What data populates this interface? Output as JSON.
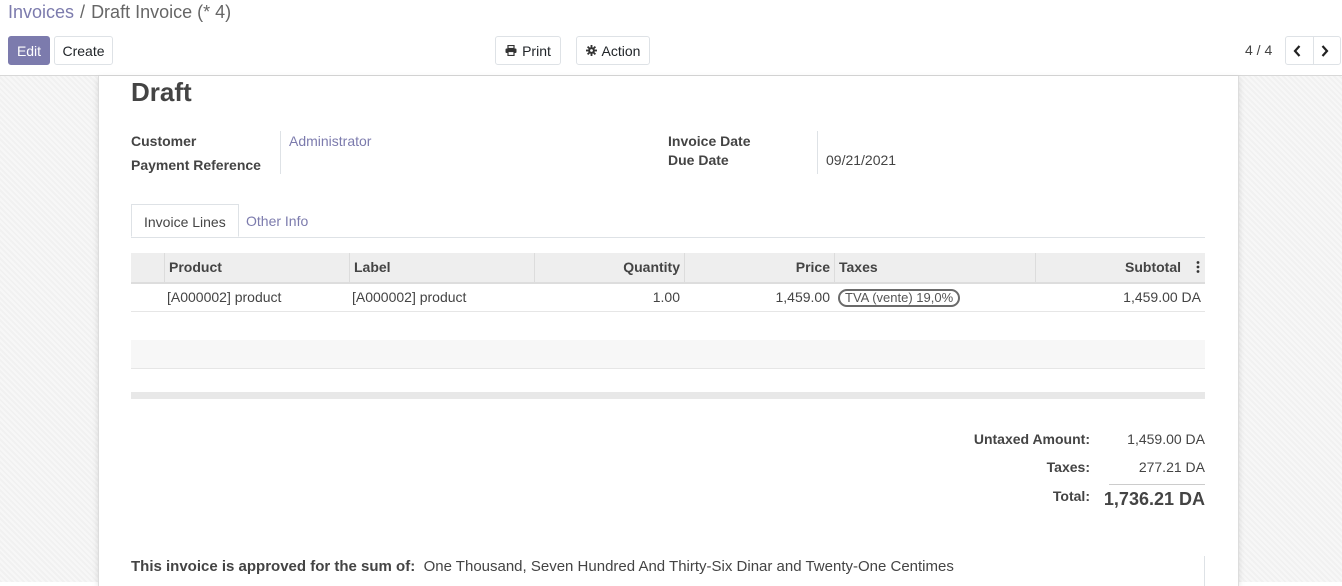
{
  "breadcrumb": {
    "parent": "Invoices",
    "separator": "/",
    "current": "Draft Invoice (* 4)"
  },
  "toolbar": {
    "edit": "Edit",
    "create": "Create",
    "print": "Print",
    "action": "Action"
  },
  "pager": {
    "value": "4 / 4"
  },
  "form": {
    "status": "Draft",
    "customer_label": "Customer",
    "customer_value": "Administrator",
    "payment_ref_label": "Payment Reference",
    "payment_ref_value": "",
    "invoice_date_label": "Invoice Date",
    "invoice_date_value": "",
    "due_date_label": "Due Date",
    "due_date_value": "09/21/2021"
  },
  "tabs": [
    {
      "label": "Invoice Lines"
    },
    {
      "label": "Other Info"
    }
  ],
  "lines_table": {
    "columns": [
      "Product",
      "Label",
      "Quantity",
      "Price",
      "Taxes",
      "Subtotal"
    ],
    "rows": [
      {
        "product": "[A000002] product",
        "label": "[A000002] product",
        "quantity": "1.00",
        "price": "1,459.00",
        "taxes": "TVA (vente) 19,0%",
        "subtotal": "1,459.00 DA"
      }
    ]
  },
  "totals": {
    "untaxed_label": "Untaxed Amount:",
    "untaxed_value": "1,459.00 DA",
    "taxes_label": "Taxes:",
    "taxes_value": "277.21 DA",
    "total_label": "Total:",
    "total_value": "1,736.21 DA"
  },
  "amount_in_words": {
    "label": "This invoice is approved for the sum of:",
    "value": "One Thousand, Seven Hundred And Thirty-Six Dinar and Twenty-One Centimes"
  },
  "icons": {
    "print": "printer-icon",
    "action": "gear-icon",
    "prev": "chevron-left-icon",
    "next": "chevron-right-icon",
    "column_options": "kebab-icon"
  },
  "colors": {
    "brand": "#7c7bad"
  }
}
